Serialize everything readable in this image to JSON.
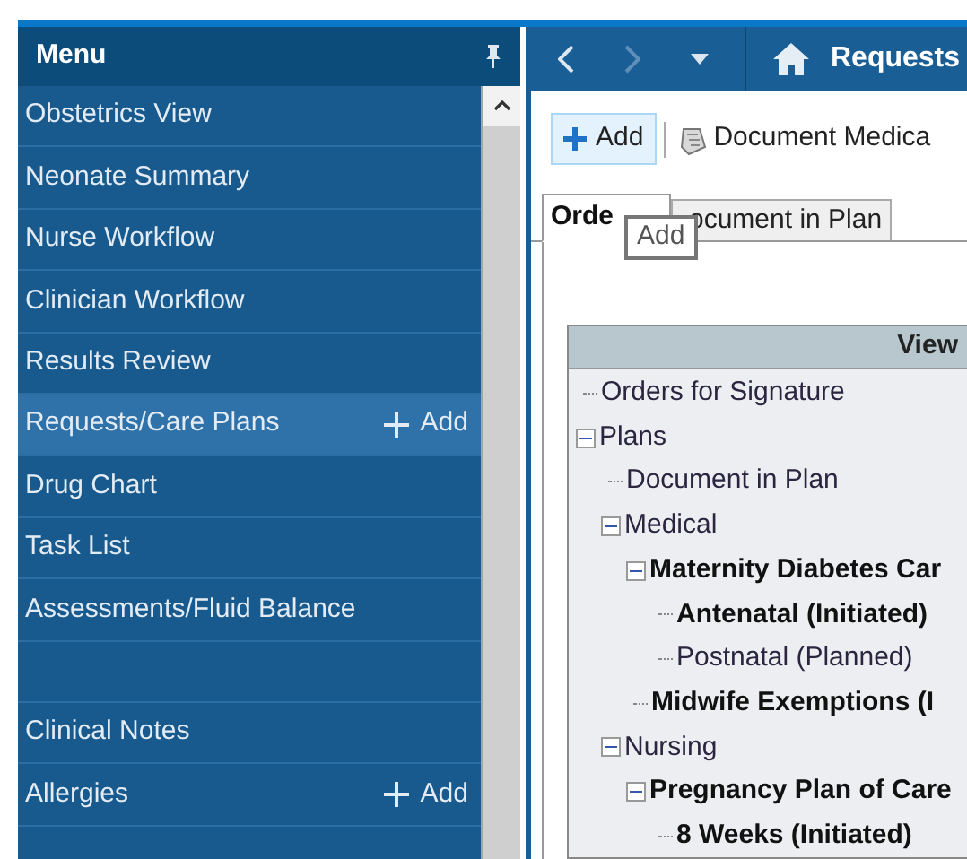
{
  "sidebar": {
    "title": "Menu",
    "items": [
      {
        "kind": "link",
        "label": "Obstetrics View",
        "selected": false
      },
      {
        "kind": "link",
        "label": "Neonate Summary",
        "selected": false
      },
      {
        "kind": "link",
        "label": "Nurse Workflow",
        "selected": false
      },
      {
        "kind": "link",
        "label": "Clinician Workflow",
        "selected": false
      },
      {
        "kind": "link",
        "label": "Results Review",
        "selected": false
      },
      {
        "kind": "link",
        "label": "Requests/Care Plans",
        "selected": true,
        "action": "Add"
      },
      {
        "kind": "link",
        "label": "Drug Chart",
        "selected": false
      },
      {
        "kind": "link",
        "label": "Task List",
        "selected": false
      },
      {
        "kind": "link",
        "label": "Assessments/Fluid Balance",
        "selected": false
      },
      {
        "kind": "blank"
      },
      {
        "kind": "link",
        "label": "Clinical Notes",
        "selected": false
      },
      {
        "kind": "link",
        "label": "Allergies",
        "selected": false,
        "action": "Add"
      }
    ]
  },
  "nav": {
    "title": "Requests"
  },
  "toolbar": {
    "buttons": [
      {
        "kind": "add",
        "label": "Add"
      },
      {
        "kind": "document",
        "label": "Document Medica"
      }
    ]
  },
  "tabs": [
    {
      "label": "Orde",
      "selected": true
    },
    {
      "label": "ocument in Plan",
      "selected": false
    }
  ],
  "tooltip": "Add",
  "tree": {
    "header": "View",
    "items": [
      {
        "label": "Orders for Signature",
        "bold": false
      },
      {
        "label": "Plans",
        "bold": false,
        "expanded": true,
        "children": [
          {
            "label": "Document in Plan",
            "bold": false
          },
          {
            "label": "Medical",
            "bold": false,
            "expanded": true,
            "children": [
              {
                "label": "Maternity Diabetes Car",
                "bold": true,
                "expanded": true,
                "children": [
                  {
                    "label": "Antenatal (Initiated)",
                    "bold": true
                  },
                  {
                    "label": "Postnatal (Planned)",
                    "bold": false
                  }
                ]
              },
              {
                "label": "Midwife Exemptions (I",
                "bold": true
              }
            ]
          },
          {
            "label": "Nursing",
            "bold": false,
            "expanded": true,
            "children": [
              {
                "label": "Pregnancy Plan of Care",
                "bold": true,
                "expanded": true,
                "children": [
                  {
                    "label": "8 Weeks (Initiated)",
                    "bold": true
                  }
                ]
              }
            ]
          }
        ]
      }
    ]
  }
}
